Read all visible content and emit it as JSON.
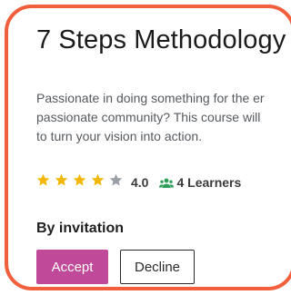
{
  "course": {
    "title": "7 Steps Methodology",
    "description_lines": [
      "Passionate in doing something for the er",
      "passionate community? This course will",
      "to turn your vision into action."
    ],
    "rating": {
      "value": "4.0",
      "stars_filled": 4,
      "stars_total": 5
    },
    "learners": "4 Learners",
    "access": "By invitation"
  },
  "actions": {
    "accept_label": "Accept",
    "decline_label": "Decline"
  },
  "colors": {
    "frame_border": "#f25f3c",
    "star_filled": "#f2b705",
    "star_empty": "#9a9fa6",
    "learners_icon": "#2e9e58",
    "accept_bg": "#c0499a"
  },
  "icons": {
    "star": "star-icon",
    "learners": "users-icon"
  }
}
